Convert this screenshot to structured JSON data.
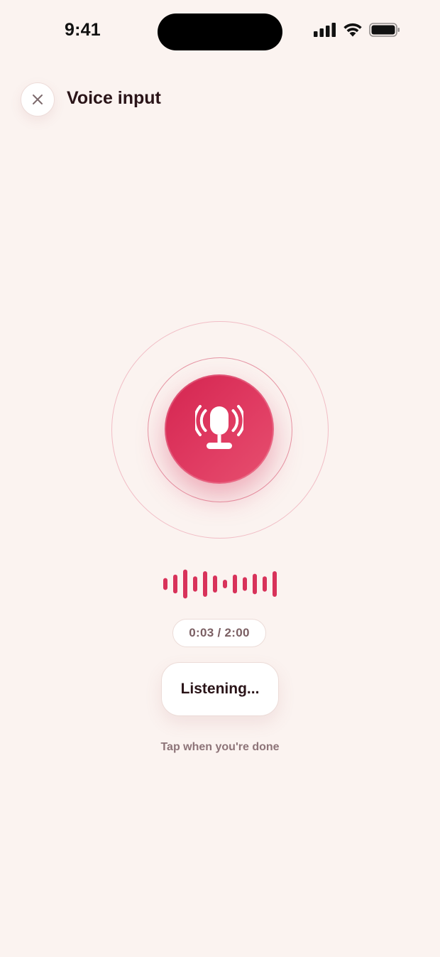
{
  "status_bar": {
    "time": "9:41"
  },
  "header": {
    "title": "Voice input",
    "close_icon": "close-icon"
  },
  "mic": {
    "icon": "microphone-broadcast-icon",
    "active": true
  },
  "waveform": {
    "bar_levels": [
      0.35,
      0.55,
      0.85,
      0.45,
      0.75,
      0.5,
      0.25,
      0.55,
      0.4,
      0.6,
      0.45,
      0.75
    ],
    "color": "#d8325a"
  },
  "timer": {
    "text": "0:03 / 2:00"
  },
  "listening_button": {
    "label": "Listening..."
  },
  "hint": {
    "text": "Tap when you're done"
  },
  "colors": {
    "background": "#fbf3f0",
    "accent": "#d9305a",
    "title_text": "#2a1418",
    "muted_text": "#8d7478"
  }
}
